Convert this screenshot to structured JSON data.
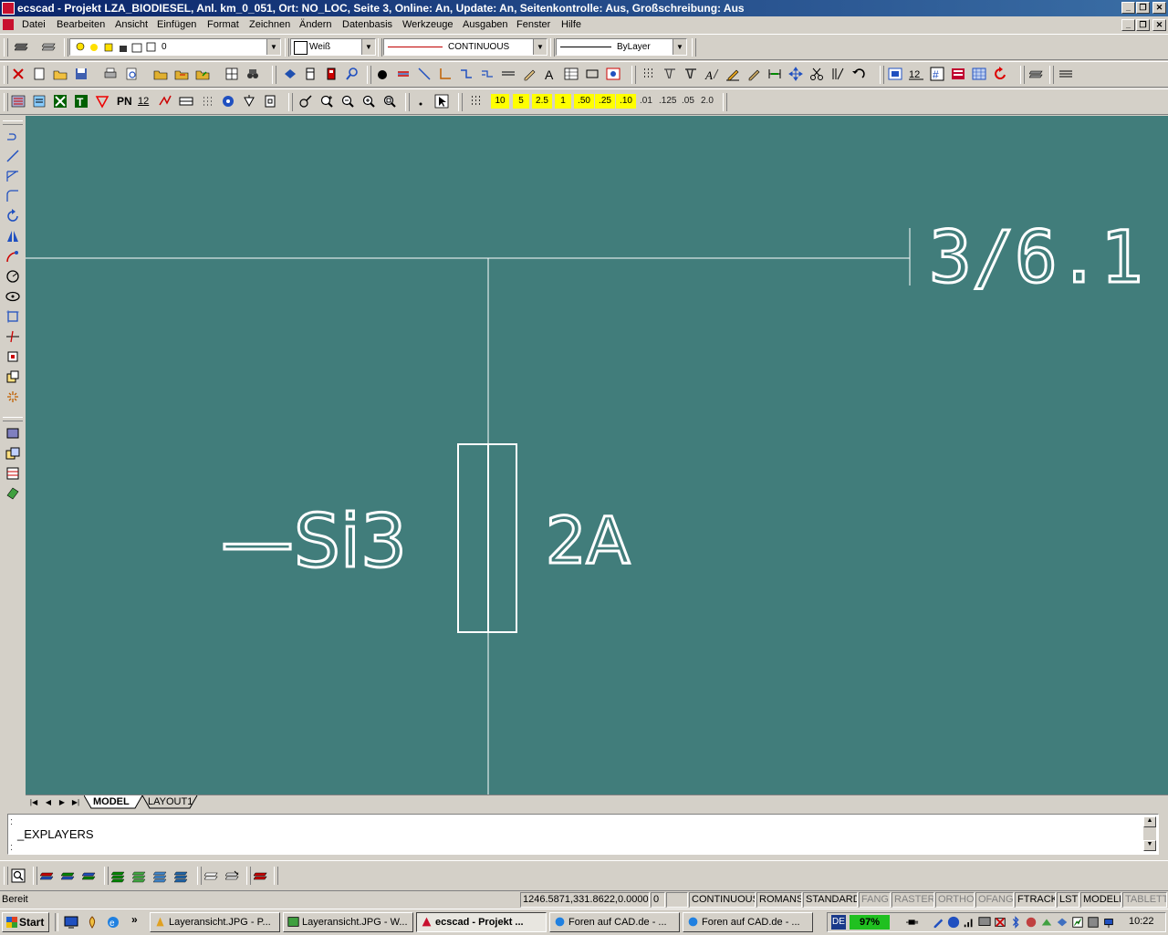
{
  "window": {
    "title": "ecscad  - Projekt LZA_BIODIESEL,  Anl. km_0_051,  Ort: NO_LOC,  Seite 3,  Online: An,  Update: An,  Seitenkontrolle: Aus,  Großschreibung: Aus"
  },
  "menu": [
    "Datei",
    "Bearbeiten",
    "Ansicht",
    "Einfügen",
    "Format",
    "Zeichnen",
    "Ändern",
    "Datenbasis",
    "Werkzeuge",
    "Ausgaben",
    "Fenster",
    "Hilfe"
  ],
  "properties": {
    "layer": "0",
    "color": "Weiß",
    "linetype": "CONTINUOUS",
    "lineweight": "ByLayer"
  },
  "toolbar3": {
    "pn_label": "PN",
    "num_label": "12",
    "scales": [
      "10",
      "5",
      "2.5",
      "1",
      ".50",
      ".25",
      ".10"
    ],
    "scales_gray": [
      ".01",
      ".125",
      ".05",
      "2.0"
    ]
  },
  "drawing": {
    "reference": "3/6.1",
    "device_tag": "—Si3",
    "fuse_rating": "2A",
    "colors": {
      "background": "#417d7b",
      "lines": "#ffffff"
    }
  },
  "tabs": [
    "MODEL",
    "LAYOUT1"
  ],
  "command": {
    "text": "_EXPLAYERS"
  },
  "status": {
    "ready": "Bereit",
    "coords": "1246.5871,331.8622,0.0000",
    "num": "0",
    "fields": [
      "CONTINUOUS",
      "ROMANS",
      "STANDARD"
    ],
    "toggles": [
      {
        "label": "FANG",
        "on": false
      },
      {
        "label": "RASTER",
        "on": false
      },
      {
        "label": "ORTHO",
        "on": false
      },
      {
        "label": "OFANG",
        "on": false
      },
      {
        "label": "FTRACK",
        "on": true
      },
      {
        "label": "LST",
        "on": true
      },
      {
        "label": "MODELL",
        "on": true
      },
      {
        "label": "TABLETT",
        "on": false
      }
    ]
  },
  "taskbar": {
    "start": "Start",
    "quick_more": "»",
    "tasks": [
      "Layeransicht.JPG - P...",
      "Layeransicht.JPG - W...",
      "ecscad  - Projekt ...",
      "Foren auf CAD.de - ...",
      "Foren auf CAD.de - ..."
    ],
    "active_task": 2,
    "lang": "DE",
    "battery": "97%",
    "clock": "10:22"
  }
}
